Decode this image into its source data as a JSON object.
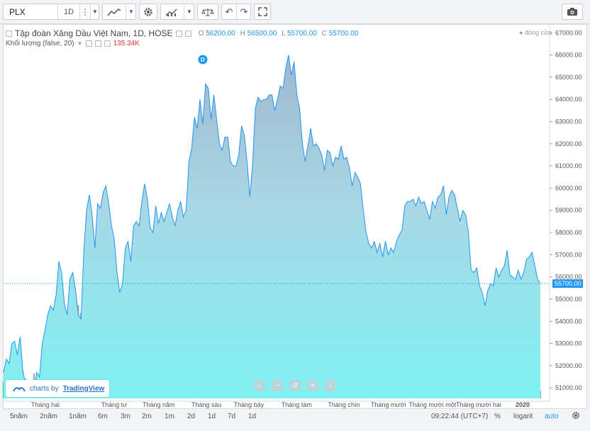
{
  "toolbar": {
    "symbol": "PLX",
    "interval": "1D"
  },
  "legend": {
    "title": "Tập đoàn Xăng Dầu Việt Nam, 1D, HOSE",
    "o_label": "O",
    "o_value": "56200.00",
    "h_label": "H",
    "h_value": "56500.00",
    "l_label": "L",
    "l_value": "55700.00",
    "c_label": "C",
    "c_value": "55700.00",
    "volume_label": "Khối lượng (false, 20)",
    "volume_value": "135.34K",
    "close_indicator": "đóng cửa"
  },
  "credit": {
    "prefix": "charts by",
    "brand": "TradingView"
  },
  "bottom": {
    "ranges": [
      "5năm",
      "2năm",
      "1năm",
      "6m",
      "3m",
      "2m",
      "1m",
      "2d",
      "1d",
      "7d",
      "1d"
    ],
    "time": "09:22:44 (UTC+7)",
    "percent": "%",
    "log": "logarit",
    "auto": "auto"
  },
  "colors": {
    "line": "#2196f3",
    "price_badge": "#2196f3",
    "volume_up": "#33d3a0",
    "volume_down": "#a8acb0",
    "volume_text": "#e0383e"
  },
  "chart_data": {
    "type": "area",
    "title": "Tập đoàn Xăng Dầu Việt Nam, 1D, HOSE",
    "xlabel": "",
    "ylabel": "",
    "ylim": [
      50400,
      67200
    ],
    "yticks": [
      51000,
      52000,
      53000,
      54000,
      55000,
      56000,
      57000,
      58000,
      59000,
      60000,
      61000,
      62000,
      63000,
      64000,
      65000,
      66000,
      67000
    ],
    "ytick_labels": [
      "51000.00",
      "52000.00",
      "53000.00",
      "54000.00",
      "55000.00",
      "56000.00",
      "57000.00",
      "58000.00",
      "59000.00",
      "60000.00",
      "61000.00",
      "62000.00",
      "63000.00",
      "64000.00",
      "65000.00",
      "66000.00",
      "67000.00"
    ],
    "x_categories": [
      "Tháng hai",
      "Tháng tư",
      "Tháng năm",
      "Tháng sáu",
      "Tháng bảy",
      "Tháng tám",
      "Tháng chín",
      "Tháng mười",
      "Tháng mười một",
      "Tháng mười hai",
      "2020"
    ],
    "last_price": 55700,
    "last_price_label": "55700.00",
    "event_marker": "D",
    "series": [
      {
        "values": [
          51700,
          52300,
          52100,
          53000,
          53100,
          52500,
          53300,
          51700,
          51200,
          51200,
          51300,
          50900,
          51700,
          51500,
          53000,
          53600,
          54300,
          54700,
          54500,
          55200,
          56700,
          56200,
          54800,
          54300,
          55900,
          56200,
          55400,
          54300,
          54100,
          57200,
          59000,
          59700,
          58800,
          57300,
          59300,
          59100,
          59800,
          60100,
          59300,
          58300,
          57700,
          56200,
          55300,
          55700,
          57300,
          57600,
          56700,
          58300,
          58500,
          58300,
          59400,
          60200,
          59500,
          58200,
          58000,
          59200,
          58400,
          58900,
          58500,
          58900,
          59300,
          58700,
          58300,
          59000,
          59400,
          58700,
          59000,
          61200,
          61800,
          63200,
          62700,
          64000,
          62900,
          64700,
          64500,
          63100,
          64200,
          63100,
          62000,
          61700,
          62300,
          62300,
          61200,
          61000,
          61000,
          61500,
          62800,
          62400,
          61200,
          59600,
          61100,
          63600,
          64100,
          63900,
          64000,
          64000,
          64200,
          64200,
          63500,
          64000,
          64600,
          64500,
          65400,
          66000,
          65100,
          65700,
          64200,
          63600,
          62000,
          61200,
          61900,
          62700,
          61900,
          62000,
          61800,
          61500,
          60800,
          61700,
          61600,
          61000,
          61400,
          61300,
          61900,
          61300,
          61400,
          60900,
          60100,
          60700,
          60500,
          60200,
          59000,
          58000,
          57500,
          57300,
          57600,
          57100,
          57500,
          56900,
          57600,
          57000,
          57300,
          57100,
          57600,
          57900,
          58100,
          59200,
          59400,
          59400,
          59500,
          59200,
          59600,
          59300,
          59400,
          59000,
          58600,
          59400,
          59100,
          59600,
          59700,
          60100,
          58800,
          59600,
          59900,
          59700,
          59100,
          58500,
          59000,
          58800,
          58000,
          56300,
          56200,
          56400,
          55600,
          55300,
          54700,
          55400,
          55700,
          55600,
          56400,
          56000,
          56300,
          56500,
          57200,
          56100,
          56000,
          55900,
          56300,
          55900,
          56200,
          56800,
          56900,
          57100,
          56500,
          55900,
          55700
        ]
      }
    ],
    "volume_bars_approx_count": 205
  }
}
